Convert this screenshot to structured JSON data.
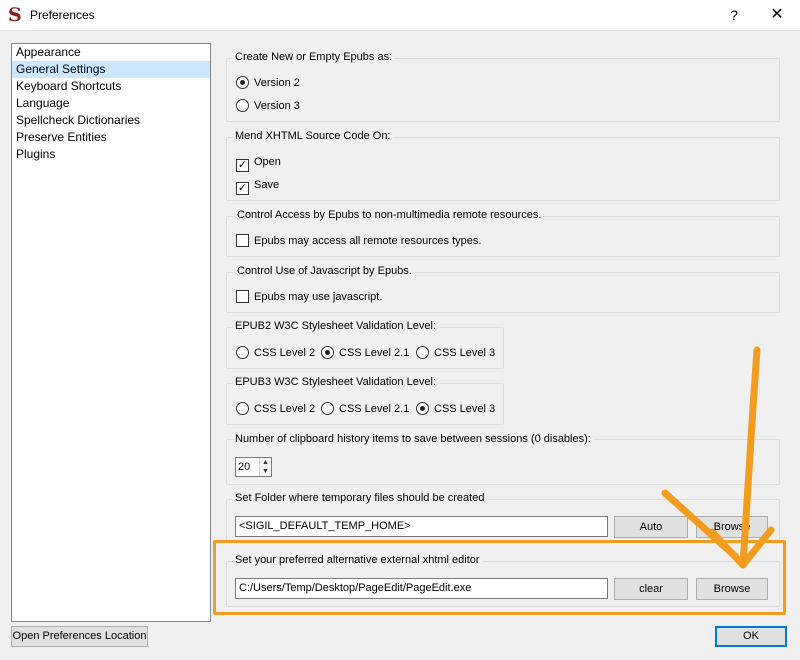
{
  "window": {
    "title": "Preferences",
    "help": "?",
    "close": "✕",
    "app_icon": "S"
  },
  "sidebar": {
    "items": [
      {
        "label": "Appearance"
      },
      {
        "label": "General Settings",
        "selected": true
      },
      {
        "label": "Keyboard Shortcuts"
      },
      {
        "label": "Language"
      },
      {
        "label": "Spellcheck Dictionaries"
      },
      {
        "label": "Preserve Entities"
      },
      {
        "label": "Plugins"
      }
    ]
  },
  "epub_version": {
    "title": "Create New or Empty Epubs as:",
    "options": [
      "Version 2",
      "Version 3"
    ],
    "selected": "Version 2"
  },
  "mend": {
    "title": "Mend XHTML Source Code On:",
    "options": [
      {
        "label": "Open",
        "checked": true
      },
      {
        "label": "Save",
        "checked": true
      }
    ]
  },
  "remote": {
    "title": "Control Access by Epubs to non-multimedia remote resources.",
    "option": "Epubs may access all remote resources types.",
    "checked": false
  },
  "javascript": {
    "title": "Control Use of Javascript by Epubs.",
    "option": "Epubs may use javascript.",
    "checked": false
  },
  "epub2_css": {
    "title": "EPUB2 W3C Stylesheet Validation Level:",
    "options": [
      "CSS Level 2",
      "CSS Level 2.1",
      "CSS Level 3"
    ],
    "selected": "CSS Level 2.1"
  },
  "epub3_css": {
    "title": "EPUB3 W3C Stylesheet Validation Level:",
    "options": [
      "CSS Level 2",
      "CSS Level 2.1",
      "CSS Level 3"
    ],
    "selected": "CSS Level 3"
  },
  "clipboard": {
    "title": "Number of clipboard history items to save between sessions (0 disables):",
    "value": "20"
  },
  "temp_folder": {
    "title": "Set Folder where temporary files should be created",
    "value": "<SIGIL_DEFAULT_TEMP_HOME>",
    "auto_label": "Auto",
    "browse_label": "Browse"
  },
  "xhtml_editor": {
    "title": "Set your preferred alternative external xhtml editor",
    "value": "C:/Users/Temp/Desktop/PageEdit/PageEdit.exe",
    "clear_label": "clear",
    "browse_label": "Browse"
  },
  "footer": {
    "open_location_label": "Open Preferences Location",
    "ok_label": "OK"
  },
  "annotation_color": "#f39c1f"
}
